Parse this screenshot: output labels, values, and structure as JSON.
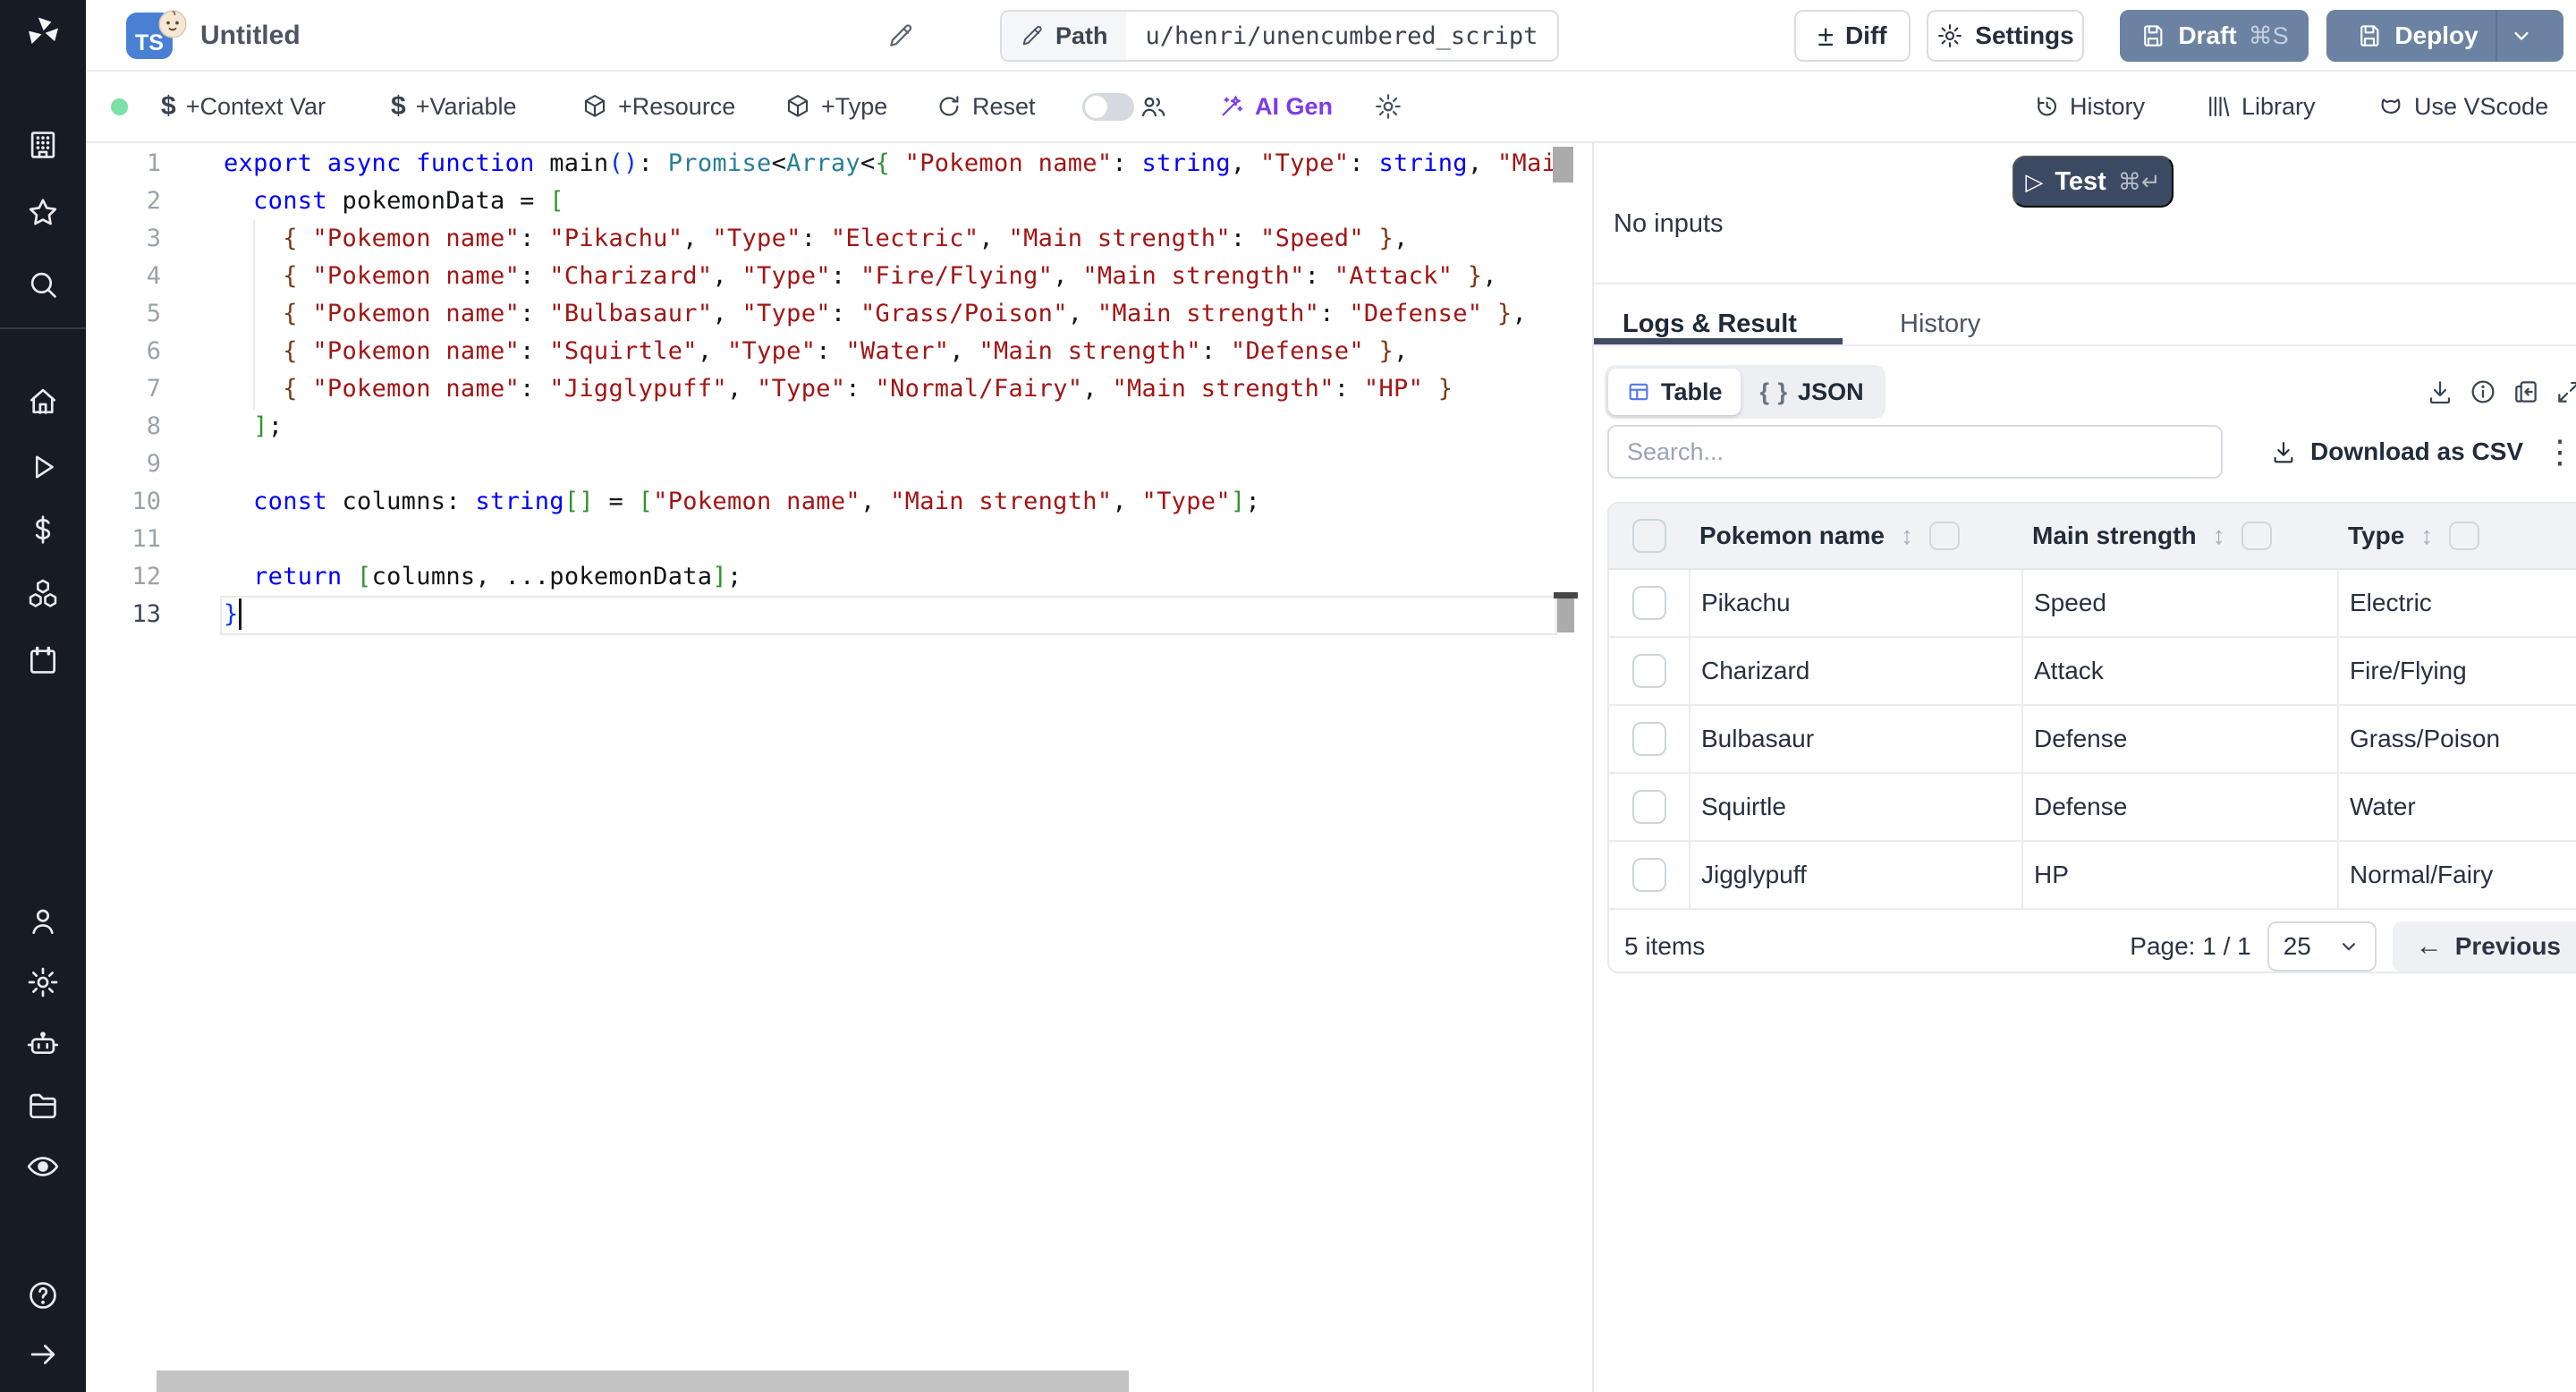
{
  "colors": {
    "brand_slate_button": "#6b82a3",
    "test_button": "#3b4962",
    "ai_gen_accent": "#7c3aed",
    "status_dot_green": "#7de0a6",
    "ts_badge_blue": "#4a80d4",
    "active_tab_underline": "#3e4c66",
    "table_view_icon_blue": "#4f78e8"
  },
  "sidebar": {
    "icons": [
      "windmill-logo",
      "workspace",
      "favorites",
      "search",
      "home",
      "runs",
      "variables",
      "resources",
      "schedules",
      "users",
      "settings",
      "workers",
      "folders",
      "audit-logs",
      "help",
      "expand"
    ]
  },
  "topbar": {
    "language_badge": "TS",
    "title": "Untitled",
    "path_label": "Path",
    "path_value": "u/henri/unencumbered_script",
    "diff_label": "Diff",
    "settings_label": "Settings",
    "draft_label": "Draft",
    "draft_shortcut": "⌘S",
    "deploy_label": "Deploy"
  },
  "toolbar": {
    "context_var_label": "+Context Var",
    "variable_label": "+Variable",
    "resource_label": "+Resource",
    "type_label": "+Type",
    "reset_label": "Reset",
    "ai_gen_label": "AI Gen",
    "history_label": "History",
    "library_label": "Library",
    "vscode_label": "Use VScode"
  },
  "editor": {
    "active_line": 13,
    "lines": [
      [
        [
          "k",
          "export "
        ],
        [
          "k",
          "async "
        ],
        [
          "k",
          "function "
        ],
        [
          "p",
          "main"
        ],
        [
          "b1",
          "()"
        ],
        [
          "p",
          ": "
        ],
        [
          "t",
          "Promise"
        ],
        [
          "p",
          "<"
        ],
        [
          "t",
          "Array"
        ],
        [
          "p",
          "<"
        ],
        [
          "b2",
          "{ "
        ],
        [
          "s",
          "\"Pokemon name\""
        ],
        [
          "p",
          ": "
        ],
        [
          "k",
          "string"
        ],
        [
          "p",
          ", "
        ],
        [
          "s",
          "\"Type\""
        ],
        [
          "p",
          ": "
        ],
        [
          "k",
          "string"
        ],
        [
          "p",
          ", "
        ],
        [
          "s",
          "\"Mai"
        ]
      ],
      [
        [
          "p",
          "  "
        ],
        [
          "k",
          "const"
        ],
        [
          "p",
          " pokemonData = "
        ],
        [
          "b2",
          "["
        ]
      ],
      [
        [
          "p",
          "    "
        ],
        [
          "b3",
          "{ "
        ],
        [
          "s",
          "\"Pokemon name\""
        ],
        [
          "p",
          ": "
        ],
        [
          "s",
          "\"Pikachu\""
        ],
        [
          "p",
          ", "
        ],
        [
          "s",
          "\"Type\""
        ],
        [
          "p",
          ": "
        ],
        [
          "s",
          "\"Electric\""
        ],
        [
          "p",
          ", "
        ],
        [
          "s",
          "\"Main strength\""
        ],
        [
          "p",
          ": "
        ],
        [
          "s",
          "\"Speed\""
        ],
        [
          "b3",
          " }"
        ],
        [
          "p",
          ","
        ]
      ],
      [
        [
          "p",
          "    "
        ],
        [
          "b3",
          "{ "
        ],
        [
          "s",
          "\"Pokemon name\""
        ],
        [
          "p",
          ": "
        ],
        [
          "s",
          "\"Charizard\""
        ],
        [
          "p",
          ", "
        ],
        [
          "s",
          "\"Type\""
        ],
        [
          "p",
          ": "
        ],
        [
          "s",
          "\"Fire/Flying\""
        ],
        [
          "p",
          ", "
        ],
        [
          "s",
          "\"Main strength\""
        ],
        [
          "p",
          ": "
        ],
        [
          "s",
          "\"Attack\""
        ],
        [
          "b3",
          " }"
        ],
        [
          "p",
          ","
        ]
      ],
      [
        [
          "p",
          "    "
        ],
        [
          "b3",
          "{ "
        ],
        [
          "s",
          "\"Pokemon name\""
        ],
        [
          "p",
          ": "
        ],
        [
          "s",
          "\"Bulbasaur\""
        ],
        [
          "p",
          ", "
        ],
        [
          "s",
          "\"Type\""
        ],
        [
          "p",
          ": "
        ],
        [
          "s",
          "\"Grass/Poison\""
        ],
        [
          "p",
          ", "
        ],
        [
          "s",
          "\"Main strength\""
        ],
        [
          "p",
          ": "
        ],
        [
          "s",
          "\"Defense\""
        ],
        [
          "b3",
          " }"
        ],
        [
          "p",
          ","
        ]
      ],
      [
        [
          "p",
          "    "
        ],
        [
          "b3",
          "{ "
        ],
        [
          "s",
          "\"Pokemon name\""
        ],
        [
          "p",
          ": "
        ],
        [
          "s",
          "\"Squirtle\""
        ],
        [
          "p",
          ", "
        ],
        [
          "s",
          "\"Type\""
        ],
        [
          "p",
          ": "
        ],
        [
          "s",
          "\"Water\""
        ],
        [
          "p",
          ", "
        ],
        [
          "s",
          "\"Main strength\""
        ],
        [
          "p",
          ": "
        ],
        [
          "s",
          "\"Defense\""
        ],
        [
          "b3",
          " }"
        ],
        [
          "p",
          ","
        ]
      ],
      [
        [
          "p",
          "    "
        ],
        [
          "b3",
          "{ "
        ],
        [
          "s",
          "\"Pokemon name\""
        ],
        [
          "p",
          ": "
        ],
        [
          "s",
          "\"Jigglypuff\""
        ],
        [
          "p",
          ", "
        ],
        [
          "s",
          "\"Type\""
        ],
        [
          "p",
          ": "
        ],
        [
          "s",
          "\"Normal/Fairy\""
        ],
        [
          "p",
          ", "
        ],
        [
          "s",
          "\"Main strength\""
        ],
        [
          "p",
          ": "
        ],
        [
          "s",
          "\"HP\""
        ],
        [
          "b3",
          " }"
        ]
      ],
      [
        [
          "p",
          "  "
        ],
        [
          "b2",
          "]"
        ],
        [
          "p",
          ";"
        ]
      ],
      [],
      [
        [
          "p",
          "  "
        ],
        [
          "k",
          "const"
        ],
        [
          "p",
          " columns: "
        ],
        [
          "k",
          "string"
        ],
        [
          "b2",
          "[]"
        ],
        [
          "p",
          " = "
        ],
        [
          "b2",
          "["
        ],
        [
          "s",
          "\"Pokemon name\""
        ],
        [
          "p",
          ", "
        ],
        [
          "s",
          "\"Main strength\""
        ],
        [
          "p",
          ", "
        ],
        [
          "s",
          "\"Type\""
        ],
        [
          "b2",
          "]"
        ],
        [
          "p",
          ";"
        ]
      ],
      [],
      [
        [
          "p",
          "  "
        ],
        [
          "k",
          "return"
        ],
        [
          "p",
          " "
        ],
        [
          "b2",
          "["
        ],
        [
          "p",
          "columns, ...pokemonData"
        ],
        [
          "b2",
          "]"
        ],
        [
          "p",
          ";"
        ]
      ],
      [
        [
          "b1",
          "}"
        ]
      ]
    ]
  },
  "run_panel": {
    "test_label": "Test",
    "test_shortcut": "⌘↵",
    "no_inputs": "No inputs"
  },
  "result_panel": {
    "tabs": [
      "Logs & Result",
      "History"
    ],
    "view_tabs": [
      "Table",
      "JSON"
    ],
    "json_icon": "{ }",
    "toolbar_icons": [
      "download",
      "info",
      "copy-to-clipboard",
      "expand",
      "kebab-menu"
    ],
    "search_placeholder": "Search...",
    "download_csv_label": "Download as CSV",
    "table": {
      "headers": [
        "Pokemon name",
        "Main strength",
        "Type"
      ],
      "rows": [
        [
          "Pikachu",
          "Speed",
          "Electric"
        ],
        [
          "Charizard",
          "Attack",
          "Fire/Flying"
        ],
        [
          "Bulbasaur",
          "Defense",
          "Grass/Poison"
        ],
        [
          "Squirtle",
          "Defense",
          "Water"
        ],
        [
          "Jigglypuff",
          "HP",
          "Normal/Fairy"
        ]
      ]
    },
    "footer": {
      "items_label": "5 items",
      "page_label": "Page: 1 / 1",
      "page_size": "25",
      "previous_label": "Previous"
    }
  }
}
